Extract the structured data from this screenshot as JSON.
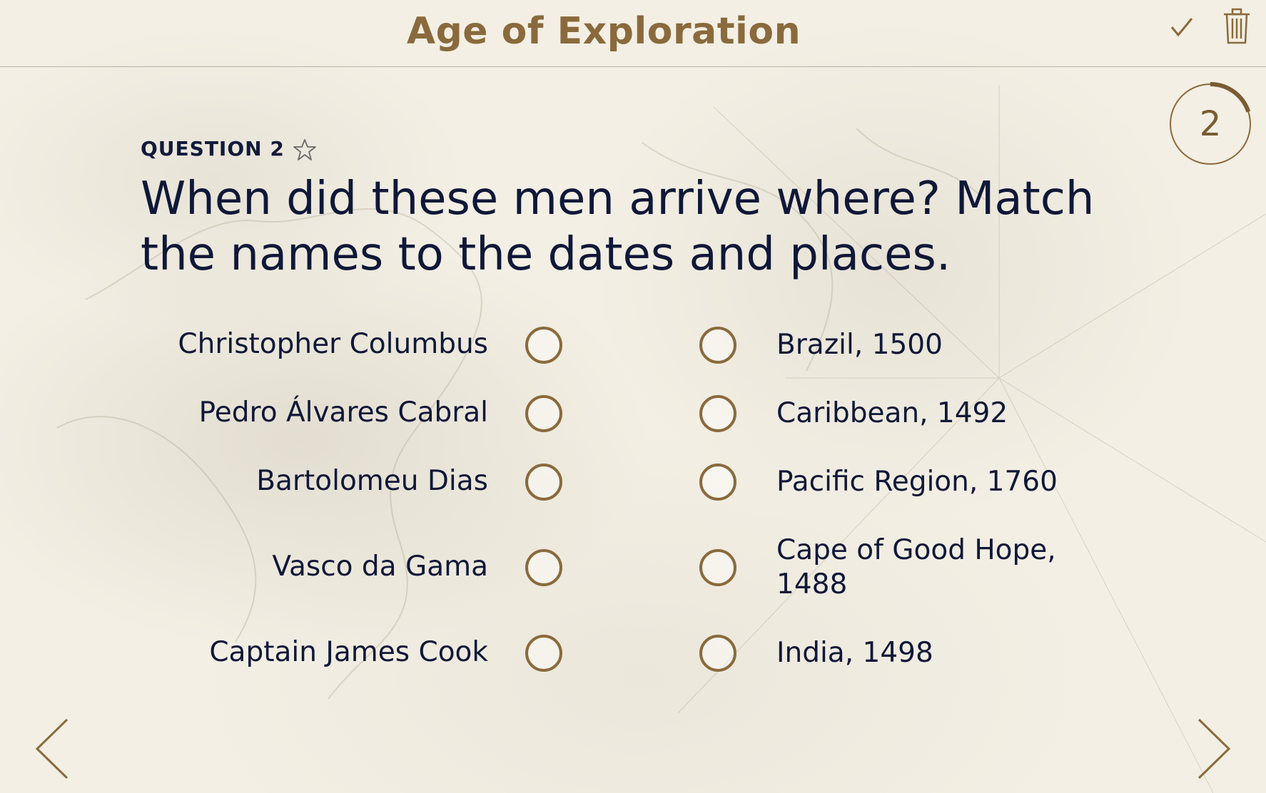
{
  "header": {
    "title": "Age of Exploration",
    "actions": [
      "check-icon",
      "trash-icon"
    ]
  },
  "counter": {
    "value": "2",
    "progress": 0.2
  },
  "question": {
    "label": "QUESTION 2",
    "text": "When did these men arrive where? Match the names to the dates and places."
  },
  "left_items": [
    "Christopher Columbus",
    "Pedro Álvares Cabral",
    "Bartolomeu Dias",
    "Vasco da Gama",
    "Captain James Cook"
  ],
  "right_items": [
    "Brazil, 1500",
    "Caribbean, 1492",
    "Pacific Region, 1760",
    "Cape of Good Hope, 1488",
    "India, 1498"
  ],
  "nav": {
    "prev_icon": "chevron-left-icon",
    "next_icon": "chevron-right-icon"
  },
  "colors": {
    "accent": "#8a6a3c",
    "text": "#0f1838",
    "background": "#f3efe4"
  }
}
